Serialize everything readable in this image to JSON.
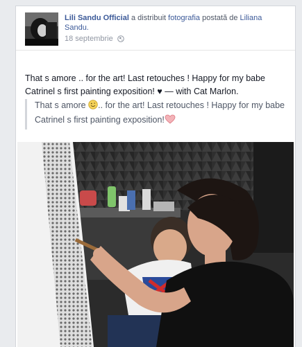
{
  "post": {
    "author": "Lili Sandu Official",
    "shared_text": "a distribuit",
    "shared_object": "fotografia",
    "posted_by_text": "postată de",
    "original_author": "Liliana Sandu.",
    "date": "18 septembrie",
    "privacy_icon": "globe-icon",
    "text_before": "That s amore .. for the art! Last retouches ! Happy for my babe Catrinel s first painting exposition! ",
    "text_heart": "♥",
    "with_prefix": " — with ",
    "with_person": "Cat Marlon.",
    "quote_part1": "That s amore ",
    "quote_part2": ".. for the art! Last retouches ! Happy for my babe Catrinel s first painting exposition!"
  },
  "colors": {
    "link": "#3b5998",
    "meta_grey": "#9197a3",
    "card_border": "#d3d6db",
    "background": "#e9ebee"
  }
}
